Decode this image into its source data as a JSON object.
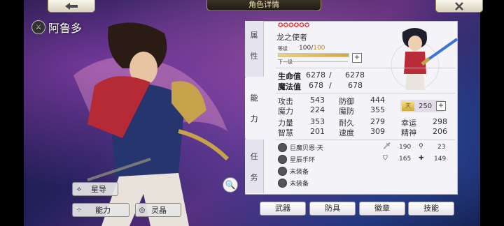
{
  "header": {
    "title": "角色详情"
  },
  "character": {
    "name": "阿鲁多"
  },
  "left_buttons": {
    "star_guide": "星导",
    "ability": "能力",
    "spirit_crystal": "灵晶"
  },
  "tabs": {
    "attribute_1": "属",
    "attribute_2": "性",
    "ability_1": "能",
    "ability_2": "力",
    "task_1": "任",
    "task_2": "务"
  },
  "profile": {
    "stars": "✪✪✪✪✪✪",
    "title": "龙之使者",
    "level_label": "等级",
    "level": "100",
    "level_sep": "/",
    "level_max": "100",
    "level_progress": 1.0,
    "next_label": "下一级"
  },
  "vitals": {
    "hp_label": "生命值",
    "hp": "6278",
    "hp_sep": "/",
    "hp_max": "6278",
    "mp_label": "魔法值",
    "mp": "678",
    "mp_sep": "/",
    "mp_max": "678"
  },
  "stats": [
    {
      "l1": "攻击",
      "v1": "543",
      "l2": "防御",
      "v2": "444"
    },
    {
      "l1": "魔力",
      "v1": "224",
      "l2": "魔防",
      "v2": "355"
    },
    {
      "l1": "力量",
      "v1": "353",
      "l2": "耐久",
      "v2": "279",
      "l3": "幸运",
      "v3": "298"
    },
    {
      "l1": "智慧",
      "v1": "201",
      "l2": "速度",
      "v2": "309",
      "l3": "精神",
      "v3": "206"
    }
  ],
  "points": {
    "icon_text": "天",
    "value": "250"
  },
  "equipment": [
    {
      "name": "巨魔贝恩·天",
      "a": "190",
      "b": "23"
    },
    {
      "name": "星辰手环",
      "a": "165",
      "b": "149"
    },
    {
      "name": "未装备"
    },
    {
      "name": "未装备"
    }
  ],
  "bottom_buttons": {
    "weapon": "武器",
    "armor": "防具",
    "badge": "徽章",
    "skill": "技能"
  },
  "colors": {
    "accent": "#d6a838",
    "panel": "#f4f3f8",
    "star": "#d4373a"
  }
}
